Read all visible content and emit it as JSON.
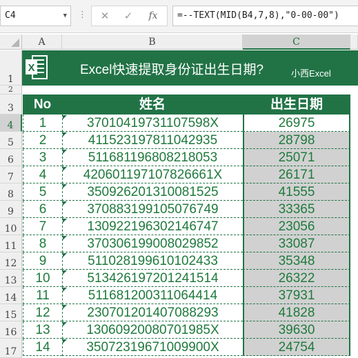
{
  "formula_bar": {
    "name_box": "C4",
    "dots": "⋮",
    "cancel_icon": "✕",
    "enter_icon": "✓",
    "fx_label": "fx",
    "formula": "=--TEXT(MID(B4,7,8),\"0-00-00\")"
  },
  "columns": [
    "A",
    "B",
    "C"
  ],
  "selected_column": "C",
  "banner": {
    "title": "Excel快速提取身份证出生日期?",
    "subtitle": "小西Excel"
  },
  "table": {
    "headers": [
      "No",
      "姓名",
      "出生日期"
    ],
    "rows": [
      {
        "no": "1",
        "id": "37010419731107598X",
        "date": "26975"
      },
      {
        "no": "2",
        "id": "411523197811042935",
        "date": "28798"
      },
      {
        "no": "3",
        "id": "511681196808218053",
        "date": "25071"
      },
      {
        "no": "4",
        "id": "420601197107826661X",
        "date": "26171"
      },
      {
        "no": "5",
        "id": "350926201310081525",
        "date": "41555"
      },
      {
        "no": "6",
        "id": "370883199105076749",
        "date": "33365"
      },
      {
        "no": "7",
        "id": "130922196302146747",
        "date": "23056"
      },
      {
        "no": "8",
        "id": "370306199008029852",
        "date": "33087"
      },
      {
        "no": "9",
        "id": "511028199610102433",
        "date": "35348"
      },
      {
        "no": "10",
        "id": "513426197201241514",
        "date": "26322"
      },
      {
        "no": "11",
        "id": "511681200311064414",
        "date": "37931"
      },
      {
        "no": "12",
        "id": "230701201407088293",
        "date": "41828"
      },
      {
        "no": "13",
        "id": "13060920080701985X",
        "date": "39630"
      },
      {
        "no": "14",
        "id": "35072319671009900X",
        "date": "24754"
      }
    ]
  },
  "row_numbers": [
    "1",
    "2",
    "3",
    "4",
    "5",
    "6",
    "7",
    "8",
    "9",
    "10",
    "11",
    "12",
    "13",
    "14",
    "15",
    "16",
    "17"
  ],
  "colors": {
    "excel_green": "#217346",
    "selection_gray": "#d1d1d1"
  }
}
